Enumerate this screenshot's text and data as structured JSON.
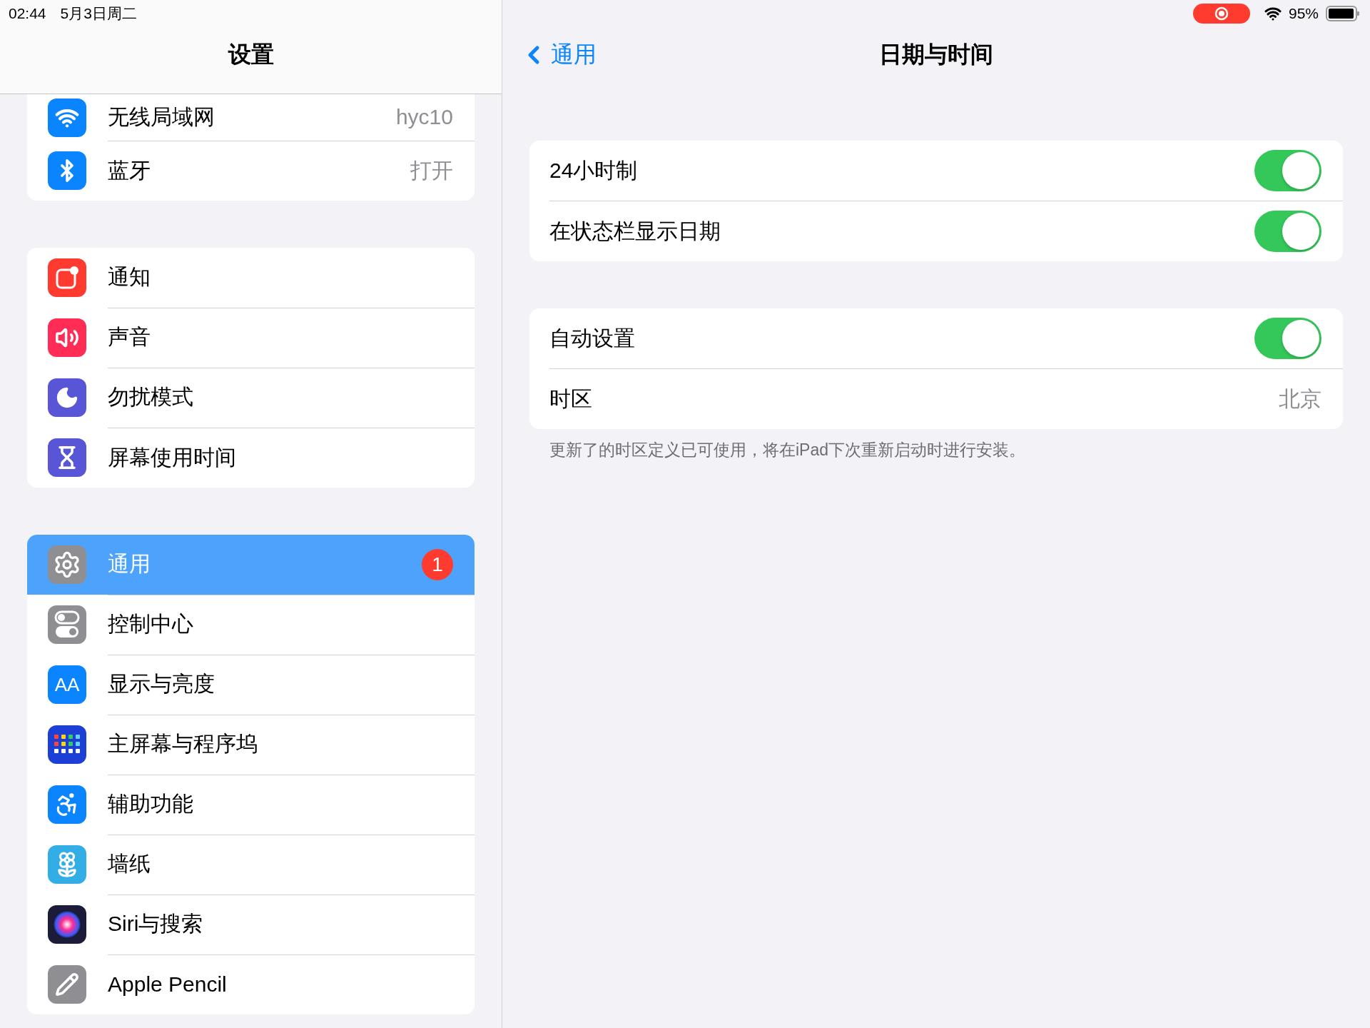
{
  "status_bar": {
    "time": "02:44",
    "date": "5月3日周二",
    "recording": true,
    "battery": "95%"
  },
  "sidebar": {
    "title": "设置",
    "groups": [
      [
        {
          "label": "无线局域网",
          "kind": "wifi",
          "value": "hyc10",
          "selected": false
        },
        {
          "label": "蓝牙",
          "kind": "bluetooth",
          "value": "打开",
          "selected": false
        }
      ],
      [
        {
          "label": "通知",
          "kind": "notifications",
          "selected": false
        },
        {
          "label": "声音",
          "kind": "sound",
          "selected": false
        },
        {
          "label": "勿扰模式",
          "kind": "moon",
          "selected": false
        },
        {
          "label": "屏幕使用时间",
          "kind": "hourglass",
          "selected": false
        }
      ],
      [
        {
          "label": "通用",
          "kind": "gear",
          "badge": "1",
          "selected": true
        },
        {
          "label": "控制中心",
          "kind": "switches",
          "selected": false
        },
        {
          "label": "显示与亮度",
          "kind": "text",
          "icon_text": "AA",
          "selected": false
        },
        {
          "label": "主屏幕与程序坞",
          "kind": "grid",
          "selected": false
        },
        {
          "label": "辅助功能",
          "kind": "accessibility",
          "selected": false
        },
        {
          "label": "墙纸",
          "kind": "flower",
          "selected": false
        },
        {
          "label": "Siri与搜索",
          "kind": "siri",
          "selected": false
        },
        {
          "label": "Apple Pencil",
          "kind": "pencil",
          "selected": false
        }
      ]
    ]
  },
  "detail": {
    "back": "通用",
    "title": "日期与时间",
    "groups": [
      {
        "rows": [
          {
            "kind": "toggle",
            "label": "24小时制",
            "on": true
          },
          {
            "kind": "toggle",
            "label": "在状态栏显示日期",
            "on": true
          }
        ]
      },
      {
        "rows": [
          {
            "kind": "toggle",
            "label": "自动设置",
            "on": true
          },
          {
            "kind": "value",
            "label": "时区",
            "value": "北京"
          }
        ],
        "footer": "更新了的时区定义已可使用，将在iPad下次重新启动时进行安装。"
      }
    ]
  }
}
